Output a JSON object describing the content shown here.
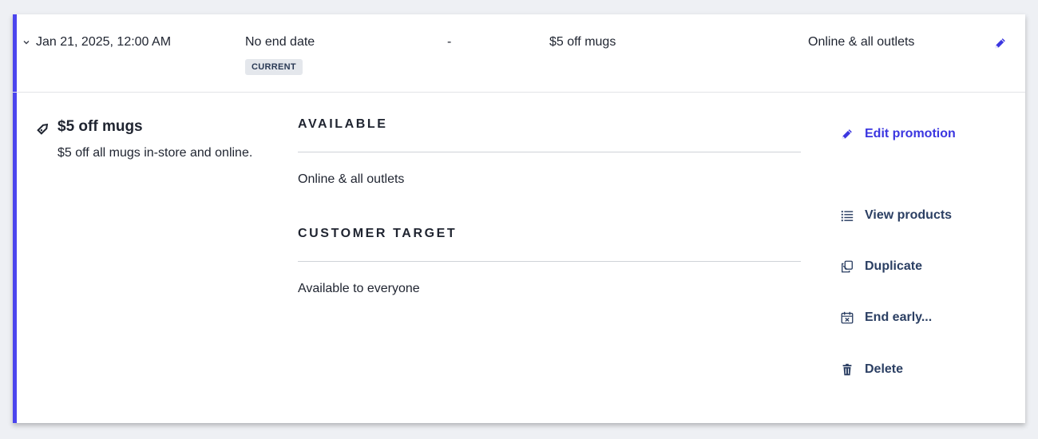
{
  "row": {
    "start": "Jan 21, 2025, 12:00 AM",
    "end": "No end date",
    "badge": "CURRENT",
    "dash": "-",
    "name": "$5 off mugs",
    "channels": "Online & all outlets"
  },
  "detail": {
    "title": "$5 off mugs",
    "description": "$5 off all mugs in-store and online.",
    "sections": [
      {
        "heading": "AVAILABLE",
        "value": "Online & all outlets"
      },
      {
        "heading": "CUSTOMER TARGET",
        "value": "Available to everyone"
      }
    ]
  },
  "actions": [
    {
      "label": "Edit promotion",
      "icon": "pencil-icon"
    },
    {
      "label": "View products",
      "icon": "list-icon"
    },
    {
      "label": "Duplicate",
      "icon": "duplicate-icon"
    },
    {
      "label": "End early...",
      "icon": "calendar-x-icon"
    },
    {
      "label": "Delete",
      "icon": "trash-icon"
    }
  ],
  "colors": {
    "accent": "#4b45ee",
    "primary_action": "#3b36e0",
    "action_text": "#2b3f63",
    "badge_bg": "#e4e7ec"
  }
}
